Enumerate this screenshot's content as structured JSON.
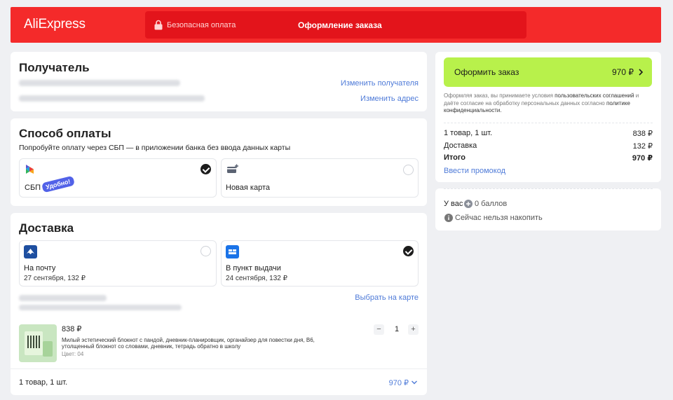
{
  "header": {
    "logo": "AliExpress",
    "secure_payment": "Безопасная оплата",
    "checkout_title": "Оформление заказа"
  },
  "recipient": {
    "title": "Получатель",
    "change_recipient": "Изменить получателя",
    "change_address": "Изменить адрес"
  },
  "payment": {
    "title": "Способ оплаты",
    "subtitle": "Попробуйте оплату через СБП — в приложении банка без ввода данных карты",
    "options": [
      {
        "label": "СБП",
        "badge": "Удобно!",
        "selected": true,
        "icon": "sbp-icon"
      },
      {
        "label": "Новая карта",
        "selected": false,
        "icon": "add-card-icon"
      }
    ]
  },
  "delivery": {
    "title": "Доставка",
    "options": [
      {
        "label": "На почту",
        "sub": "27 сентября, 132 ₽",
        "selected": false,
        "icon": "russian-post-icon"
      },
      {
        "label": "В пункт выдачи",
        "sub": "24 сентября, 132 ₽",
        "selected": true,
        "icon": "pickup-point-icon"
      }
    ],
    "map_link": "Выбрать на карте",
    "product": {
      "price": "838 ₽",
      "name_line1": "Милый эстетический блокнот с пандой, дневник-планировщик, органайзер для повестки дня, B6,",
      "name_line2": "утолщенный блокнот со словами, дневник, тетрадь обратно в школу",
      "variant": "Цвет: 04",
      "quantity": "1",
      "minus": "−",
      "plus": "+"
    },
    "footer_count": "1 товар, 1 шт.",
    "footer_total": "970 ₽"
  },
  "summary": {
    "cta_label": "Оформить заказ",
    "cta_price": "970 ₽",
    "terms_1": "Оформляя заказ, вы принимаете условия",
    "terms_link1": "пользовательских соглашений",
    "terms_2": "и даёте согласие на обработку персональных данных согласно",
    "terms_link2": "политике конфиденциальности.",
    "rows": [
      {
        "label": "1 товар, 1 шт.",
        "value": "838 ₽"
      },
      {
        "label": "Доставка",
        "value": "132 ₽"
      },
      {
        "label": "Итого",
        "value": "970 ₽"
      }
    ],
    "promo": "Ввести промокод"
  },
  "points": {
    "prefix": "У вас",
    "value": "0 баллов",
    "note": "Сейчас нельзя накопить"
  },
  "colors": {
    "brand_red": "#f42a2a",
    "cta_green": "#b8f14b",
    "link_blue": "#4f7bd8"
  }
}
